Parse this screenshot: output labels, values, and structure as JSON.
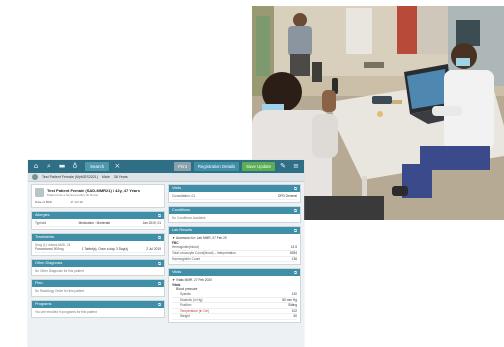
{
  "app": {
    "search_tab": "Search",
    "actions": [
      {
        "label": "Print"
      },
      {
        "label": "Registration Details"
      },
      {
        "label": "Save Update"
      }
    ]
  },
  "patient_bar": {
    "name": "Test Patient Female (MyMDS2021)",
    "sex": "Male",
    "age": "38 Years"
  },
  "patient_card": {
    "name": "Test Patient Female (SAD-MMR21) / 42y, 47 Years",
    "subtitle": "Patient has a Serious policy ID Nurse",
    "date_label": "Date of Birth",
    "date_value": "17 Jul 19"
  },
  "cards": {
    "allergies": {
      "title": "Allergies",
      "rows": [
        {
          "name": "Typhoid",
          "detail": "Medication : Moderate",
          "date": "Jan 2019, 01"
        }
      ]
    },
    "treatment": {
      "title": "Treatments",
      "intro": "Drug (1) Unless AMD, 24",
      "rows": [
        {
          "name": "Paracetamol 500mg",
          "detail": "1 Tablet(s), Once a day, 3 Day(s)",
          "date": "2 Jul 2019"
        }
      ]
    },
    "other_diagnosis": {
      "title": "Other Diagnosis",
      "text": "No Other Diagnosis for this patient"
    },
    "plan": {
      "title": "Plan",
      "text": "No Radiology Order for this patient"
    },
    "programs": {
      "title": "Programs",
      "text": "You are enrolled in programs for this patient"
    },
    "visit": {
      "title": "Visits",
      "rows": [
        {
          "name": "Consultation, 01",
          "value": "OPD General"
        }
      ]
    },
    "conditions": {
      "title": "Conditions",
      "text": "No Conditions Available"
    },
    "lab_results": {
      "title": "Lab Results",
      "intro": "▼ Accession for: Lab MMR, 27 Feb 20",
      "group": "FBC",
      "rows": [
        {
          "name": "Hemoglobin(blood)",
          "value": "13.5"
        },
        {
          "name": "Total Leucocyte Count(blood) – Interpretation",
          "value": "6354"
        },
        {
          "name": "Haemoglobin Count",
          "value": "136"
        }
      ]
    },
    "vitals": {
      "title": "Vitals",
      "intro": "▼ Vitals MMR, 27 Feb 2020",
      "group": "Vitals",
      "sub": "Blood pressure",
      "rows": [
        {
          "name": "Systolic",
          "value": "120",
          "alert": false
        },
        {
          "name": "Diastolic (in Hg)",
          "value": "80 mm Hg",
          "alert": false
        },
        {
          "name": "Position",
          "value": "Sitting",
          "alert": false
        },
        {
          "name": "Temperature (in Cel)",
          "value": "102",
          "alert": true
        },
        {
          "name": "Weight",
          "value": "60",
          "alert": false
        }
      ]
    }
  },
  "colors": {
    "header": "#2f6f85",
    "card_header": "#3f8fa9",
    "save_button": "#5cae52"
  }
}
